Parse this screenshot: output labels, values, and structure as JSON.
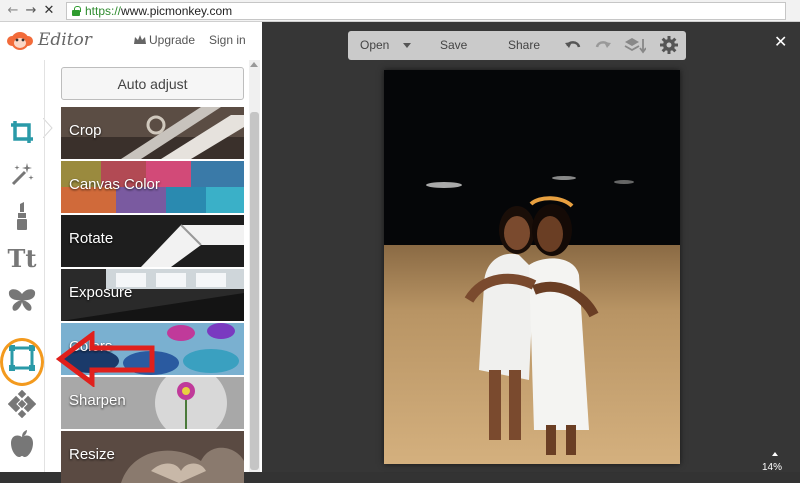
{
  "browser": {
    "url_protocol": "https://",
    "url_rest": "www.picmonkey.com",
    "back_icon": "back-arrow-icon",
    "forward_icon": "forward-arrow-icon",
    "stop_icon": "stop-icon"
  },
  "header": {
    "logo_text": "Editor",
    "upgrade_label": "Upgrade",
    "signin_label": "Sign in"
  },
  "toolbar": {
    "open_label": "Open",
    "save_label": "Save",
    "share_label": "Share"
  },
  "panel": {
    "auto_adjust_label": "Auto adjust",
    "tiles": [
      {
        "label": "Crop"
      },
      {
        "label": "Canvas Color"
      },
      {
        "label": "Rotate"
      },
      {
        "label": "Exposure"
      },
      {
        "label": "Colors"
      },
      {
        "label": "Sharpen"
      },
      {
        "label": "Resize"
      }
    ]
  },
  "tools": [
    {
      "icon": "crop-icon",
      "active": true
    },
    {
      "icon": "magic-wand-icon"
    },
    {
      "icon": "lipstick-icon"
    },
    {
      "icon": "text-icon",
      "glyph": "Tt"
    },
    {
      "icon": "butterfly-icon"
    },
    {
      "icon": "frame-icon"
    },
    {
      "icon": "texture-icon"
    },
    {
      "icon": "apple-icon"
    }
  ],
  "canvas": {
    "zoom_label": "14%"
  },
  "colors": {
    "accent": "#2a9aa8",
    "annotation_circle": "#f39a1e",
    "annotation_arrow": "#e0201c",
    "logo": "#f26b3a"
  }
}
